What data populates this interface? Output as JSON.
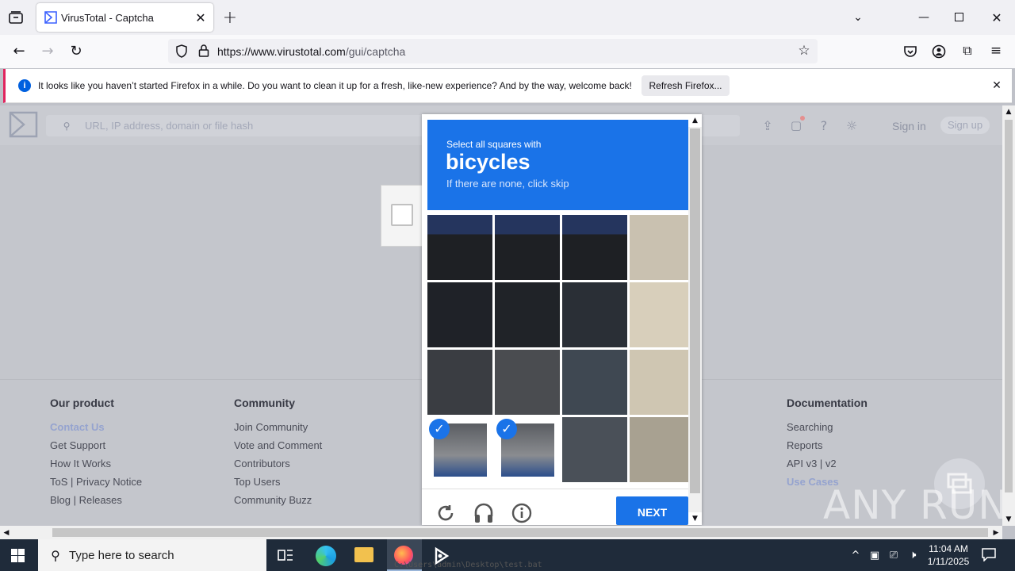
{
  "browser": {
    "tab_title": "VirusTotal - Captcha",
    "url_host": "https://www.virustotal.com",
    "url_path": "/gui/captcha"
  },
  "notification": {
    "message": "It looks like you haven’t started Firefox in a while. Do you want to clean it up for a fresh, like-new experience? And by the way, welcome back!",
    "button": "Refresh Firefox..."
  },
  "vt": {
    "search_placeholder": "URL, IP address, domain or file hash",
    "signin": "Sign in",
    "signup": "Sign up"
  },
  "footer": {
    "col1": {
      "heading": "Our product",
      "items": [
        "Contact Us",
        "Get Support",
        "How It Works",
        "ToS | Privacy Notice",
        "Blog | Releases"
      ]
    },
    "col2": {
      "heading": "Community",
      "items": [
        "Join Community",
        "Vote and Comment",
        "Contributors",
        "Top Users",
        "Community Buzz"
      ]
    },
    "col3": {
      "heading": "Documentation",
      "items": [
        "Searching",
        "Reports",
        "API v3 | v2",
        "Use Cases"
      ]
    }
  },
  "captcha": {
    "prompt": "Select all squares with",
    "target": "bicycles",
    "hint": "If there are none, click skip",
    "next": "NEXT",
    "selected_tiles": [
      12,
      13
    ]
  },
  "watermark": "ANY RUN",
  "taskbar": {
    "search_placeholder": "Type here to search",
    "time": "11:04 AM",
    "date": "1/11/2025",
    "console_path": "C:\\Users\\admin\\Desktop\\test.bat"
  }
}
